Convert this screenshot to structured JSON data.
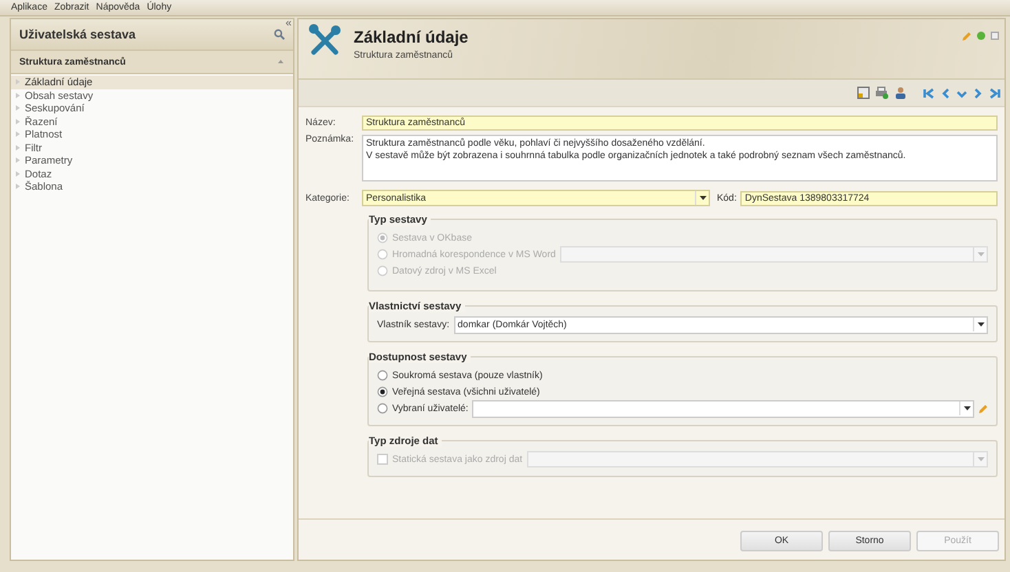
{
  "menu": [
    "Aplikace",
    "Zobrazit",
    "Nápověda",
    "Úlohy"
  ],
  "sidebar": {
    "title": "Uživatelská sestava",
    "section": "Struktura zaměstnanců",
    "collapse": "«",
    "items": [
      {
        "label": "Základní údaje",
        "selected": true
      },
      {
        "label": "Obsah sestavy",
        "selected": false
      },
      {
        "label": "Seskupování",
        "selected": false
      },
      {
        "label": "Řazení",
        "selected": false
      },
      {
        "label": "Platnost",
        "selected": false
      },
      {
        "label": "Filtr",
        "selected": false
      },
      {
        "label": "Parametry",
        "selected": false
      },
      {
        "label": "Dotaz",
        "selected": false
      },
      {
        "label": "Šablona",
        "selected": false
      }
    ]
  },
  "header": {
    "title": "Základní údaje",
    "subtitle": "Struktura zaměstnanců"
  },
  "form": {
    "name_label": "Název:",
    "name": "Struktura zaměstnanců",
    "note_label": "Poznámka:",
    "note": "Struktura zaměstnanců podle věku, pohlaví či nejvyššího dosaženého vzdělání.\nV sestavě může být zobrazena i souhrnná tabulka podle organizačních jednotek a také podrobný seznam všech zaměstnanců.",
    "category_label": "Kategorie:",
    "category": "Personalistika",
    "code_label": "Kód:",
    "code": "DynSestava 1389803317724"
  },
  "report_type": {
    "title": "Typ sestavy",
    "disabled": true,
    "options": [
      {
        "label": "Sestava v OKbase",
        "selected": true,
        "kind": "plain"
      },
      {
        "label": "Hromadná korespondence v MS Word",
        "selected": false,
        "kind": "select"
      },
      {
        "label": "Datový zdroj v MS Excel",
        "selected": false,
        "kind": "plain"
      }
    ]
  },
  "ownership": {
    "title": "Vlastnictví sestavy",
    "owner_label": "Vlastník sestavy:",
    "owner": "domkar (Domkár Vojtěch)"
  },
  "availability": {
    "title": "Dostupnost sestavy",
    "disabled": false,
    "options": [
      {
        "label": "Soukromá sestava (pouze vlastník)",
        "selected": false,
        "kind": "plain"
      },
      {
        "label": "Veřejná sestava (všichni uživatelé)",
        "selected": true,
        "kind": "plain"
      },
      {
        "label": "Vybraní uživatelé:",
        "selected": false,
        "kind": "select-edit"
      }
    ]
  },
  "data_source": {
    "title": "Typ zdroje dat",
    "label": "Statická sestava jako zdroj dat",
    "checked": false,
    "disabled": true
  },
  "buttons": [
    {
      "label": "OK",
      "disabled": false
    },
    {
      "label": "Storno",
      "disabled": false
    },
    {
      "label": "Použít",
      "disabled": true
    }
  ]
}
